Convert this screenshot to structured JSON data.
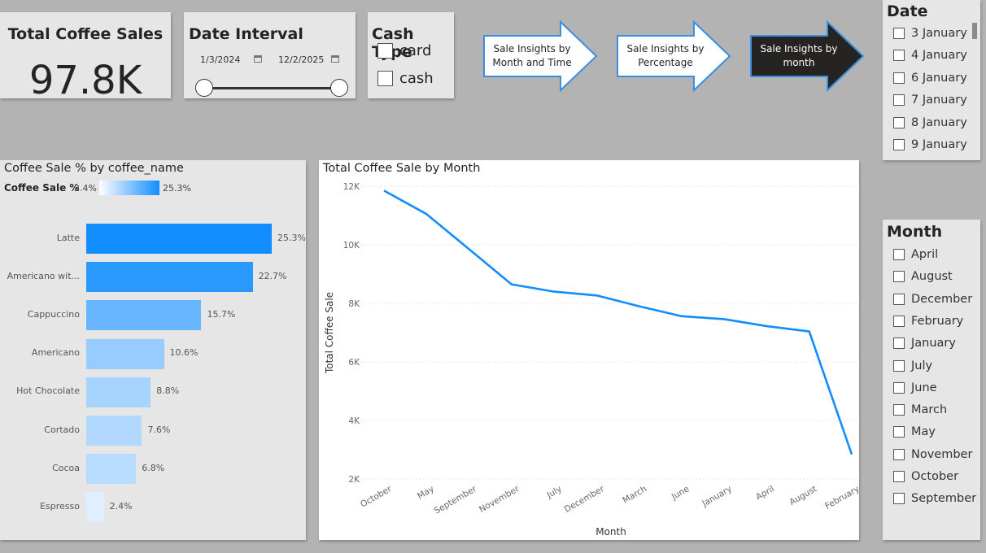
{
  "kpi": {
    "title": "Total Coffee Sales",
    "value": "97.8K"
  },
  "date_interval": {
    "title": "Date Interval",
    "start": "1/3/2024",
    "end": "12/2/2025"
  },
  "cash_type": {
    "title": "Cash Type",
    "options": [
      "card",
      "cash"
    ]
  },
  "nav_buttons": [
    {
      "label": "Sale Insights by Month and Time",
      "active": false
    },
    {
      "label": "Sale Insights by Percentage",
      "active": false
    },
    {
      "label": "Sale Insights by month",
      "active": true
    }
  ],
  "date_slicer": {
    "title": "Date",
    "items": [
      "3 January",
      "4 January",
      "6 January",
      "7 January",
      "8 January",
      "9 January"
    ]
  },
  "month_slicer": {
    "title": "Month",
    "items": [
      "April",
      "August",
      "December",
      "February",
      "January",
      "July",
      "June",
      "March",
      "May",
      "November",
      "October",
      "September"
    ]
  },
  "bar_panel": {
    "title": "Coffee Sale % by coffee_name",
    "legend_label": "Coffee Sale %",
    "legend_min": "2.4%",
    "legend_max": "25.3%"
  },
  "line_panel": {
    "title": "Total Coffee Sale by Month"
  },
  "colors": {
    "bar_max": "#118dff",
    "bar_min": "#e0efff",
    "line": "#118dff",
    "active_button": "#252423"
  },
  "chart_data": [
    {
      "type": "bar",
      "orientation": "horizontal",
      "title": "Coffee Sale % by coffee_name",
      "categories": [
        "Latte",
        "Americano wit...",
        "Cappuccino",
        "Americano",
        "Hot Chocolate",
        "Cortado",
        "Cocoa",
        "Espresso"
      ],
      "values": [
        25.3,
        22.7,
        15.7,
        10.6,
        8.8,
        7.6,
        6.8,
        2.4
      ],
      "data_labels": [
        "25.3%",
        "22.7%",
        "15.7%",
        "10.6%",
        "8.8%",
        "7.6%",
        "6.8%",
        "2.4%"
      ],
      "legend": {
        "label": "Coffee Sale %",
        "min": "2.4%",
        "max": "25.3%"
      }
    },
    {
      "type": "line",
      "title": "Total Coffee Sale by Month",
      "xlabel": "Month",
      "ylabel": "Total Coffee Sale",
      "x": [
        "October",
        "May",
        "September",
        "November",
        "July",
        "December",
        "March",
        "June",
        "January",
        "April",
        "August",
        "February"
      ],
      "series": [
        {
          "values": [
            11850,
            11050,
            9850,
            8650,
            8400,
            8270,
            7900,
            7560,
            7460,
            7220,
            7040,
            2840
          ]
        }
      ],
      "ylim": [
        2000,
        12000
      ],
      "yticks": [
        2000,
        4000,
        6000,
        8000,
        10000,
        12000
      ],
      "ytick_labels": [
        "2K",
        "4K",
        "6K",
        "8K",
        "10K",
        "12K"
      ],
      "grid": true
    }
  ]
}
